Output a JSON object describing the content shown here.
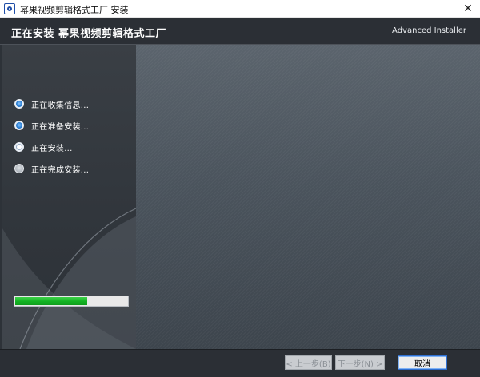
{
  "window": {
    "title": "幂果视频剪辑格式工厂 安装",
    "close_glyph": "✕"
  },
  "header": {
    "title": "正在安装 幂果视频剪辑格式工厂",
    "brand": "Advanced Installer"
  },
  "steps": [
    {
      "label": "正在收集信息...",
      "state": "done"
    },
    {
      "label": "正在准备安装...",
      "state": "done"
    },
    {
      "label": "正在安装...",
      "state": "active"
    },
    {
      "label": "正在完成安装...",
      "state": "pending"
    }
  ],
  "progress": {
    "fraction": 0.64
  },
  "footer": {
    "prev_label": "< 上一步(B)",
    "next_label": "下一步(N) >",
    "cancel_label": "取消"
  },
  "colors": {
    "header_bg": "#2b2f35",
    "progress_fill": "#14b524",
    "accent_blue": "#2a7fd4"
  },
  "icons": {
    "app": "installer-app-icon",
    "close": "close-icon"
  }
}
